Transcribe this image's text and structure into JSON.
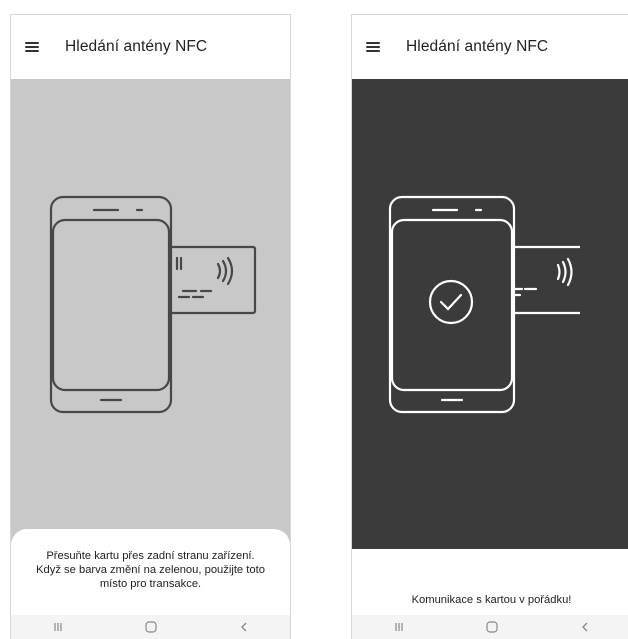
{
  "screens": [
    {
      "app_title": "Hledání antény NFC",
      "state": "searching",
      "stage_color": "#c8c8c8",
      "line_color": "#474747",
      "instruction_line1": "Přesuňte kartu přes zadní stranu zařízení.",
      "instruction_line2": "Když se barva změní na zelenou, použijte toto",
      "instruction_line3": "místo pro transakce."
    },
    {
      "app_title": "Hledání antény NFC",
      "state": "success",
      "stage_color": "#3b3b3b",
      "line_color": "#ffffff",
      "status_message": "Komunikace s kartou v pořádku!",
      "status_icon": "checkmark-circle-icon"
    }
  ],
  "icons": {
    "menu": "hamburger-menu-icon",
    "nfc": "nfc-waves-icon",
    "nav_recents": "recent-apps-icon",
    "nav_home": "home-icon",
    "nav_back": "back-icon"
  }
}
